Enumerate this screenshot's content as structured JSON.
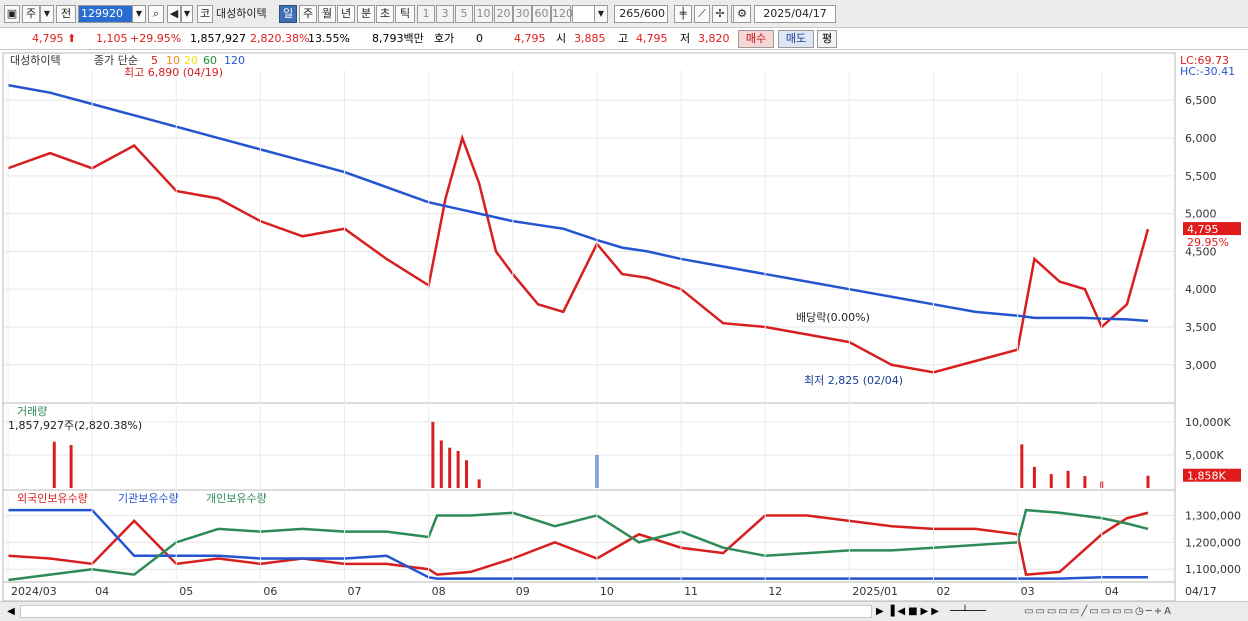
{
  "toolbar": {
    "market_btn": "주",
    "prev_btn": "전",
    "code": "129920",
    "sound_btn": "◀",
    "name_prefix": "코",
    "stock_name": "대성하이텍",
    "periods": [
      "일",
      "주",
      "월",
      "년",
      "분",
      "초",
      "틱"
    ],
    "active_period": "일",
    "intervals": [
      "1",
      "3",
      "5",
      "10",
      "20",
      "30",
      "60",
      "120"
    ],
    "count": "265",
    "count_total": "/600",
    "date": "2025/04/17"
  },
  "quote": {
    "price": "4,795",
    "change": "1,105",
    "change_pct": "+29.95%",
    "volume": "1,857,927",
    "volume_pct": "2,820.38%",
    "turnover": "13.55%",
    "amount": "8,793백만",
    "hoga_label": "호가",
    "hoga_value": "0",
    "hoga_price": "4,795",
    "open_label": "시",
    "open": "3,885",
    "high_label": "고",
    "high": "4,795",
    "low_label": "저",
    "low": "3,820",
    "buy_label": "매수",
    "sell_label": "매도",
    "eval_label": "평"
  },
  "price_panel": {
    "legend_name": "대성하이텍",
    "legend_ma_title": "종가 단순",
    "ma_periods": [
      "5",
      "10",
      "20",
      "60",
      "120"
    ],
    "ma_colors": [
      "#d71f1f",
      "#f08a1a",
      "#f2e21a",
      "#1f8f3a",
      "#2455d0"
    ],
    "lc_label": "LC:69.73",
    "hc_label": "HC:-30.41",
    "high_annotation": "최고 6,890 (04/19)",
    "low_annotation": "최저 2,825 (02/04)",
    "dividend_annotation": "배당락(0.00%)",
    "current_price_tag": "4,795",
    "current_pct_tag": "29.95%"
  },
  "volume_panel": {
    "title": "거래량",
    "info": "1,857,927주(2,820.38%)",
    "current_tag": "1,858K",
    "current_pct": "2820.38%"
  },
  "holdings_panel": {
    "legend": [
      "외국인보유수량",
      "기관보유수량",
      "개인보유수량"
    ],
    "legend_colors": [
      "#d71f1f",
      "#2455d0",
      "#2e8b57"
    ]
  },
  "xaxis_labels": [
    {
      "label": "2024/03",
      "month": 0
    },
    {
      "label": "04",
      "month": 1
    },
    {
      "label": "05",
      "month": 2
    },
    {
      "label": "06",
      "month": 3
    },
    {
      "label": "07",
      "month": 4
    },
    {
      "label": "08",
      "month": 5
    },
    {
      "label": "09",
      "month": 6
    },
    {
      "label": "10",
      "month": 7
    },
    {
      "label": "11",
      "month": 8
    },
    {
      "label": "12",
      "month": 9
    },
    {
      "label": "2025/01",
      "month": 10
    },
    {
      "label": "02",
      "month": 11
    },
    {
      "label": "03",
      "month": 12
    },
    {
      "label": "04",
      "month": 13
    }
  ],
  "xaxis_last": "04/17",
  "chart_data": [
    {
      "type": "line",
      "title": "대성하이텍 일봉",
      "ylim": [
        2600,
        6900
      ],
      "yticks": [
        3000,
        3500,
        4000,
        4500,
        5000,
        5500,
        6000,
        6500
      ],
      "ytick_labels": [
        "3,000",
        "3,500",
        "4,000",
        "4,500",
        "5,000",
        "5,500",
        "6,000",
        "6,500"
      ],
      "x_months": [
        0,
        0.5,
        1,
        1.5,
        2,
        2.5,
        3,
        3.5,
        4,
        4.5,
        5,
        5.2,
        5.4,
        5.6,
        5.8,
        6,
        6.3,
        6.6,
        7,
        7.3,
        7.6,
        8,
        8.5,
        9,
        9.5,
        10,
        10.5,
        11,
        11.5,
        12,
        12.2,
        12.5,
        12.8,
        13,
        13.3,
        13.55
      ],
      "series": [
        {
          "name": "종가",
          "values": [
            5600,
            5800,
            5600,
            5900,
            5300,
            5200,
            4900,
            4700,
            4800,
            4400,
            4050,
            5200,
            6000,
            5400,
            4500,
            4200,
            3800,
            3700,
            4600,
            4200,
            4150,
            4000,
            3550,
            3500,
            3400,
            3300,
            3000,
            2900,
            3050,
            3200,
            4400,
            4100,
            4000,
            3500,
            3800,
            4795
          ]
        },
        {
          "name": "120",
          "values": [
            6700,
            6600,
            6450,
            6300,
            6150,
            6000,
            5850,
            5700,
            5550,
            5350,
            5150,
            5100,
            5050,
            5000,
            4950,
            4900,
            4850,
            4800,
            4650,
            4550,
            4500,
            4400,
            4300,
            4200,
            4100,
            4000,
            3900,
            3800,
            3700,
            3650,
            3620,
            3620,
            3620,
            3610,
            3600,
            3580
          ]
        }
      ]
    },
    {
      "type": "bar",
      "title": "거래량",
      "ylim": [
        0,
        11500
      ],
      "yticks": [
        5000,
        10000
      ],
      "ytick_labels": [
        "5,000K",
        "10,000K"
      ],
      "unit": "K",
      "x_months": [
        0.55,
        0.75,
        5.05,
        5.15,
        5.25,
        5.35,
        5.45,
        5.6,
        7.0,
        12.05,
        12.2,
        12.4,
        12.6,
        12.8,
        13.0,
        13.55
      ],
      "values": [
        7000,
        6500,
        10000,
        7200,
        6100,
        5600,
        4200,
        1300,
        5000,
        6600,
        3200,
        2100,
        2600,
        1800,
        1000,
        1858
      ]
    },
    {
      "type": "line",
      "title": "외국인보유수량 / 기관보유수량 / 개인보유수량",
      "ylim": [
        1060000,
        1350000
      ],
      "yticks": [
        1100000,
        1200000,
        1300000
      ],
      "ytick_labels": [
        "1,100,000",
        "1,200,000",
        "1,300,000"
      ],
      "x_months": [
        0,
        0.5,
        1,
        1.5,
        2,
        2.5,
        3,
        3.5,
        4,
        4.5,
        5,
        5.1,
        5.5,
        6,
        6.5,
        7,
        7.5,
        8,
        8.5,
        9,
        9.5,
        10,
        10.5,
        11,
        11.5,
        12,
        12.1,
        12.5,
        13,
        13.3,
        13.55
      ],
      "series": [
        {
          "name": "외국인보유수량",
          "values": [
            1150000,
            1140000,
            1120000,
            1280000,
            1120000,
            1140000,
            1120000,
            1140000,
            1120000,
            1120000,
            1100000,
            1080000,
            1090000,
            1140000,
            1200000,
            1140000,
            1230000,
            1180000,
            1160000,
            1300000,
            1300000,
            1280000,
            1260000,
            1250000,
            1250000,
            1230000,
            1080000,
            1090000,
            1230000,
            1290000,
            1310000
          ]
        },
        {
          "name": "기관보유수량",
          "values": [
            1320000,
            1320000,
            1320000,
            1150000,
            1150000,
            1150000,
            1140000,
            1140000,
            1140000,
            1150000,
            1070000,
            1065000,
            1065000,
            1065000,
            1065000,
            1065000,
            1065000,
            1065000,
            1065000,
            1065000,
            1065000,
            1065000,
            1065000,
            1065000,
            1065000,
            1065000,
            1065000,
            1065000,
            1070000,
            1070000,
            1070000
          ]
        },
        {
          "name": "개인보유수량",
          "values": [
            1060000,
            1080000,
            1100000,
            1080000,
            1200000,
            1250000,
            1240000,
            1250000,
            1240000,
            1240000,
            1220000,
            1300000,
            1300000,
            1310000,
            1260000,
            1300000,
            1200000,
            1240000,
            1180000,
            1150000,
            1160000,
            1170000,
            1170000,
            1180000,
            1190000,
            1200000,
            1320000,
            1310000,
            1290000,
            1270000,
            1250000
          ]
        }
      ]
    }
  ]
}
